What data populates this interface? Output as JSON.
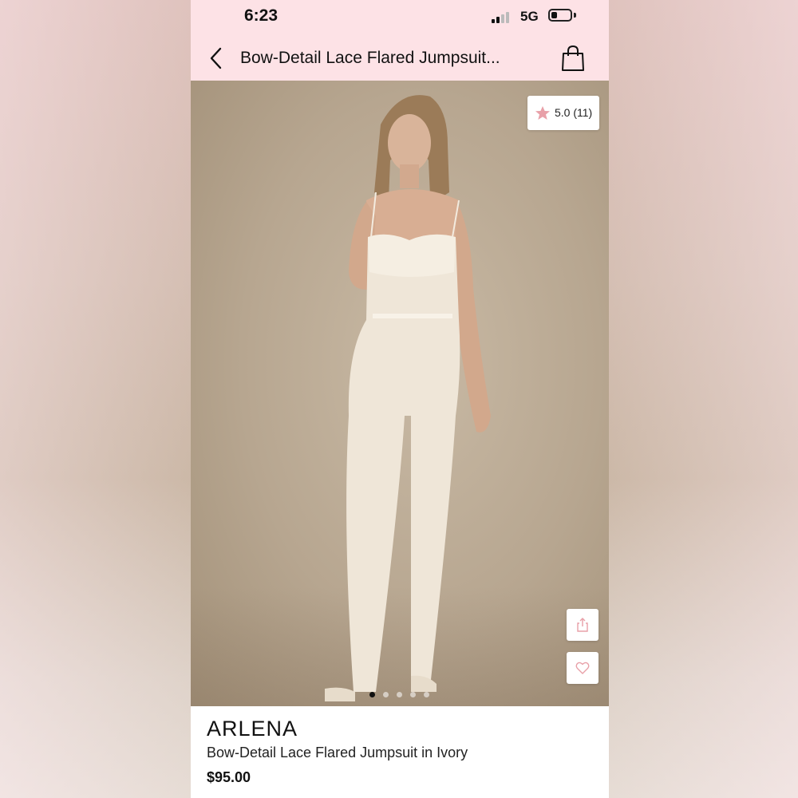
{
  "status_bar": {
    "time": "6:23",
    "network": "5G",
    "signal_icon": "cellular-signal-icon",
    "battery_icon": "battery-icon"
  },
  "nav": {
    "title": "Bow-Detail Lace Flared Jumpsuit...",
    "back_icon": "chevron-left-icon",
    "bag_icon": "shopping-bag-icon"
  },
  "gallery": {
    "image": "product-photo-model-ivory-lace-jumpsuit",
    "dots_count": 5,
    "active_index": 0
  },
  "rating": {
    "text": "5.0 (11)",
    "star_icon": "star-icon",
    "star_color": "#e8a0a8"
  },
  "actions": {
    "share_icon": "share-icon",
    "heart_icon": "heart-icon",
    "accent": "#e8a0a8"
  },
  "product": {
    "brand": "ARLENA",
    "name": "Bow-Detail Lace Flared Jumpsuit in Ivory",
    "price": "$95.00"
  },
  "colors": {
    "header_bg": "#fde2e6",
    "text": "#111111"
  }
}
